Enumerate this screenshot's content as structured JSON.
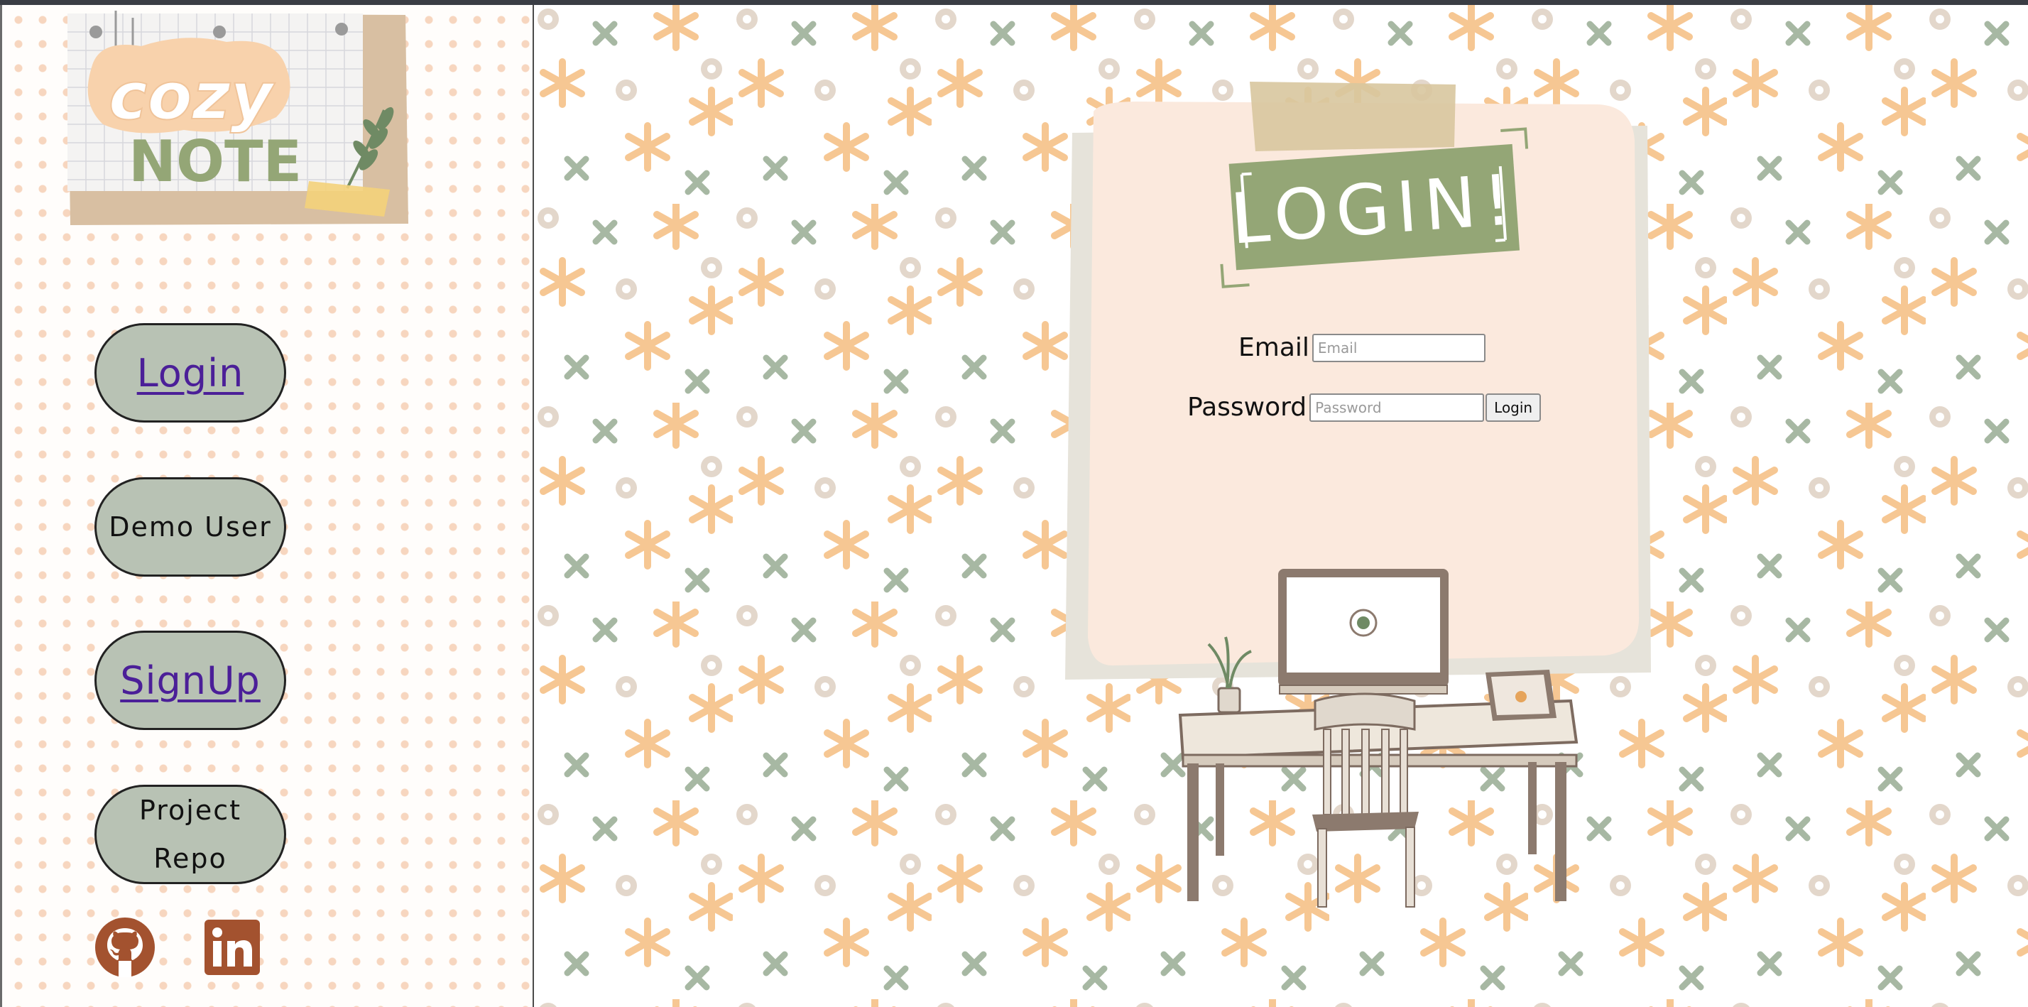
{
  "logo": {
    "line1": "cozy",
    "line2": "NOTE"
  },
  "sidebar": {
    "login": "Login",
    "demo_user": "Demo User",
    "signup": "SignUp",
    "project_repo": "Project Repo",
    "social": [
      {
        "name": "github",
        "icon": "github-icon",
        "color": "#a3522f"
      },
      {
        "name": "linkedin",
        "icon": "linkedin-icon",
        "color": "#a3522f"
      }
    ]
  },
  "login_card": {
    "title": "LOGIN!",
    "email_label": "Email",
    "email_placeholder": "Email",
    "email_value": "",
    "password_label": "Password",
    "password_placeholder": "Password",
    "password_value": "",
    "submit_label": "Login"
  },
  "colors": {
    "sage": "#94a676",
    "peach": "#fbe9dd",
    "orange_star": "#f6c793",
    "green_x": "#a7b8a3",
    "nav_button": "#b8c2b4",
    "link": "#4b1f98"
  }
}
